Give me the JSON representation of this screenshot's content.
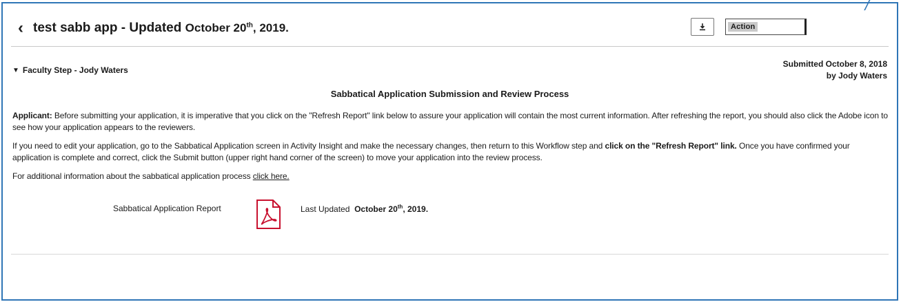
{
  "header": {
    "title_main": "test sabb app - Updated",
    "title_date_pre": "October 20",
    "title_date_sup": "th",
    "title_date_post": ", 2019.",
    "action_label": "Action"
  },
  "step": {
    "label": "Faculty Step - Jody Waters",
    "submitted_line1": "Submitted October 8, 2018",
    "submitted_line2": "by Jody Waters"
  },
  "content": {
    "section_title": "Sabbatical Application Submission and Review Process",
    "p1_bold": "Applicant:",
    "p1_text": " Before submitting your application, it is imperative that you click on the \"Refresh Report\" link below to assure your application will contain the most current information. After refreshing the report, you should also click the Adobe icon to see how your application appears to the reviewers.",
    "p2_text1": "If you need to edit your application, go to the Sabbatical Application screen in Activity Insight and make the necessary changes, then return to this Workflow step and ",
    "p2_bold": "click on the \"Refresh Report\" link.",
    "p2_text2": " Once you have confirmed your application is complete and correct, click the Submit button (upper right hand corner of the screen) to move your application into the review process.",
    "p3_text": "For additional information about the sabbatical application process ",
    "p3_link": "click here."
  },
  "report": {
    "name": "Sabbatical Application Report",
    "last_updated_label": "Last Updated",
    "date_pre": "October 20",
    "date_sup": "th",
    "date_post": ", 2019."
  },
  "colors": {
    "frame_border": "#2e75b6",
    "pdf_red": "#c8102e"
  },
  "icons": [
    "back-chevron-icon",
    "download-icon",
    "chevron-down-icon",
    "pdf-icon"
  ]
}
